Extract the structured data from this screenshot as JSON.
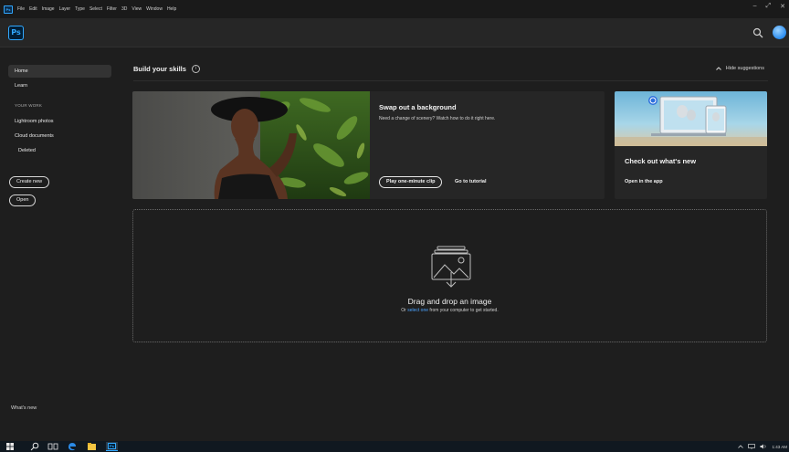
{
  "menubar": {
    "app_icon": "Ps",
    "items": [
      "File",
      "Edit",
      "Image",
      "Layer",
      "Type",
      "Select",
      "Filter",
      "3D",
      "View",
      "Window",
      "Help"
    ],
    "window_controls": [
      "–",
      "⤢",
      "✕"
    ]
  },
  "header": {
    "logo": "Ps",
    "search_icon": "search-icon"
  },
  "sidebar": {
    "home": "Home",
    "learn": "Learn",
    "section_title": "YOUR WORK",
    "lightroom": "Lightroom photos",
    "cloud": "Cloud documents",
    "deleted": "Deleted",
    "create_new": "Create new",
    "open": "Open",
    "whats_new": "What's new"
  },
  "main": {
    "skills_title": "Build your skills",
    "info": "i",
    "hide_suggestions": "Hide suggestions",
    "card1": {
      "title": "Swap out a background",
      "description": "Need a change of scenery? Watch how to do it right here.",
      "play_button": "Play one-minute clip",
      "tutorial_link": "Go to tutorial"
    },
    "card2": {
      "title": "Check out what's new",
      "link": "Open in the app"
    },
    "dropzone": {
      "title": "Drag and drop an image",
      "sub_prefix": "Or ",
      "sub_link": "select one",
      "sub_suffix": " from your computer to get started."
    }
  },
  "taskbar": {
    "time": "1:43 AM",
    "app_label": "Ps"
  },
  "colors": {
    "accent": "#31a8ff",
    "link": "#4ba3ff",
    "background": "#1e1e1e",
    "card": "#262626"
  }
}
